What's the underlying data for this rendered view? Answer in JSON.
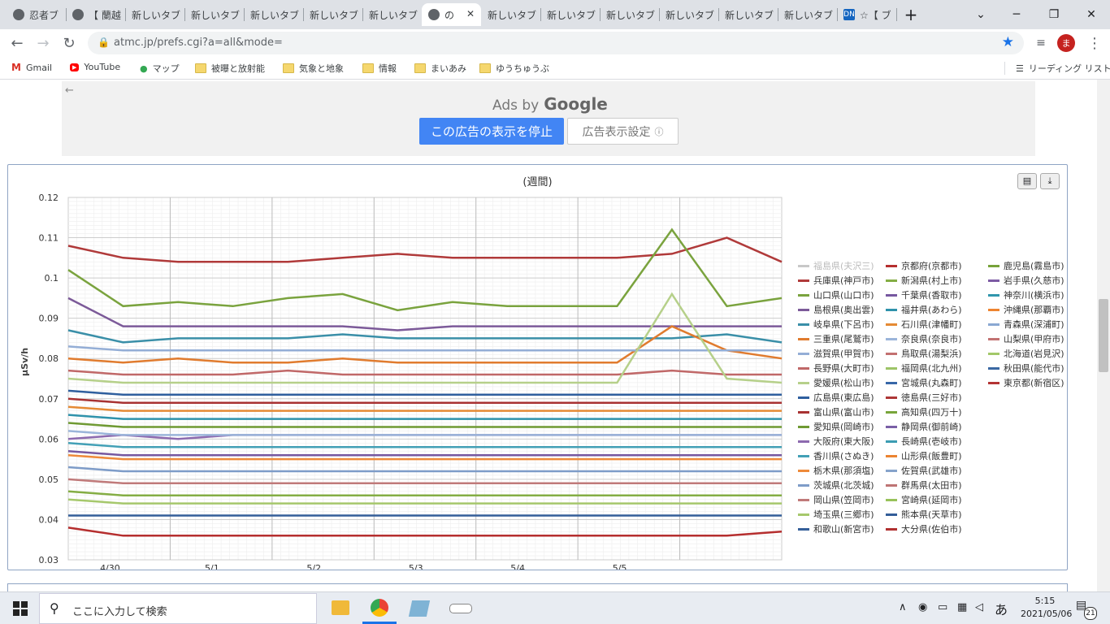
{
  "browser": {
    "tabs": [
      {
        "label": "忍者ブ",
        "icon": "globe-icon"
      },
      {
        "label": "【 蘭越",
        "icon": "globe-icon"
      },
      {
        "label": "新しいタブ",
        "icon": ""
      },
      {
        "label": "新しいタブ",
        "icon": ""
      },
      {
        "label": "新しいタブ",
        "icon": ""
      },
      {
        "label": "新しいタブ",
        "icon": ""
      },
      {
        "label": "新しいタブ",
        "icon": ""
      },
      {
        "label": "の",
        "icon": "globe-icon",
        "active": true
      },
      {
        "label": "新しいタブ",
        "icon": ""
      },
      {
        "label": "新しいタブ",
        "icon": ""
      },
      {
        "label": "新しいタブ",
        "icon": ""
      },
      {
        "label": "新しいタブ",
        "icon": ""
      },
      {
        "label": "新しいタブ",
        "icon": ""
      },
      {
        "label": "新しいタブ",
        "icon": ""
      },
      {
        "label": "☆【 ブ",
        "icon": "dn-icon"
      }
    ],
    "url": "atmc.jp/prefs.cgi?a=all&mode=",
    "profile_initial": "ま",
    "bookmarks": [
      {
        "label": "Gmail",
        "icon": "gmail-icon"
      },
      {
        "label": "YouTube",
        "icon": "youtube-icon"
      },
      {
        "label": "マップ",
        "icon": "maps-icon"
      },
      {
        "label": "被曝と放射能",
        "icon": "folder-icon"
      },
      {
        "label": "気象と地象",
        "icon": "folder-icon"
      },
      {
        "label": "情報",
        "icon": "folder-icon"
      },
      {
        "label": "まいあみ",
        "icon": "folder-icon"
      },
      {
        "label": "ゆうちゅうぶ",
        "icon": "folder-icon"
      }
    ],
    "reading_list": "リーディング リスト"
  },
  "ad": {
    "ads_by": "Ads by",
    "google": "Google",
    "stop_button": "この広告の表示を停止",
    "settings_button": "広告表示設定",
    "info_glyph": "ⓘ"
  },
  "chart_data": {
    "type": "line",
    "title": "(週間)",
    "ylabel": "μSv/h",
    "xlabel": "",
    "ylim": [
      0.03,
      0.12
    ],
    "yticks": [
      "0.12",
      "0.11",
      "0.1",
      "0.09",
      "0.08",
      "0.07",
      "0.06",
      "0.05",
      "0.04",
      "0.03"
    ],
    "xticks": [
      "4/30",
      "5/1",
      "5/2",
      "5/3",
      "5/4",
      "5/5"
    ],
    "x": [
      "4/29 12:00",
      "4/30 0:00",
      "4/30 12:00",
      "5/1 0:00",
      "5/1 12:00",
      "5/2 0:00",
      "5/2 12:00",
      "5/3 0:00",
      "5/3 12:00",
      "5/4 0:00",
      "5/4 12:00",
      "5/5 0:00",
      "5/5 12:00",
      "5/6 0:00"
    ],
    "series": [
      {
        "name": "福島県(夫沢三)",
        "color": "#c8c8c8",
        "values": [
          null,
          null,
          null,
          null,
          null,
          null,
          null,
          null,
          null,
          null,
          null,
          null,
          null,
          null
        ]
      },
      {
        "name": "兵庫県(神戸市)",
        "color": "#b03a3a",
        "values": [
          0.108,
          0.105,
          0.104,
          0.104,
          0.104,
          0.105,
          0.106,
          0.105,
          0.105,
          0.105,
          0.105,
          0.106,
          0.11,
          0.104
        ]
      },
      {
        "name": "山口県(山口市)",
        "color": "#7aa33e",
        "values": [
          0.102,
          0.093,
          0.094,
          0.093,
          0.095,
          0.096,
          0.092,
          0.094,
          0.093,
          0.093,
          0.093,
          0.112,
          0.093,
          0.095
        ]
      },
      {
        "name": "島根県(奥出雲)",
        "color": "#7c5a99",
        "values": [
          0.095,
          0.088,
          0.088,
          0.088,
          0.088,
          0.088,
          0.087,
          0.088,
          0.088,
          0.088,
          0.088,
          0.088,
          0.088,
          0.088
        ]
      },
      {
        "name": "岐阜県(下呂市)",
        "color": "#3a8fa8",
        "values": [
          0.087,
          0.084,
          0.085,
          0.085,
          0.085,
          0.086,
          0.085,
          0.085,
          0.085,
          0.085,
          0.085,
          0.085,
          0.086,
          0.084
        ]
      },
      {
        "name": "三重県(尾鷲市)",
        "color": "#e07b2e",
        "values": [
          0.08,
          0.079,
          0.08,
          0.079,
          0.079,
          0.08,
          0.079,
          0.079,
          0.079,
          0.079,
          0.079,
          0.088,
          0.082,
          0.08
        ]
      },
      {
        "name": "滋賀県(甲賀市)",
        "color": "#94aed6",
        "values": [
          0.083,
          0.082,
          0.082,
          0.082,
          0.082,
          0.082,
          0.082,
          0.082,
          0.082,
          0.082,
          0.082,
          0.082,
          0.082,
          0.082
        ]
      },
      {
        "name": "長野県(大町市)",
        "color": "#c06868",
        "values": [
          0.077,
          0.076,
          0.076,
          0.076,
          0.077,
          0.076,
          0.076,
          0.076,
          0.076,
          0.076,
          0.076,
          0.077,
          0.076,
          0.076
        ]
      },
      {
        "name": "愛媛県(松山市)",
        "color": "#b6d08a",
        "values": [
          0.075,
          0.074,
          0.074,
          0.074,
          0.074,
          0.074,
          0.074,
          0.074,
          0.074,
          0.074,
          0.074,
          0.096,
          0.075,
          0.074
        ]
      },
      {
        "name": "広島県(東広島)",
        "color": "#2f5f9e",
        "values": [
          0.072,
          0.071,
          0.071,
          0.071,
          0.071,
          0.071,
          0.071,
          0.071,
          0.071,
          0.071,
          0.071,
          0.071,
          0.071,
          0.071
        ]
      },
      {
        "name": "富山県(富山市)",
        "color": "#a83232",
        "values": [
          0.07,
          0.069,
          0.069,
          0.069,
          0.069,
          0.069,
          0.069,
          0.069,
          0.069,
          0.069,
          0.069,
          0.069,
          0.069,
          0.069
        ]
      },
      {
        "name": "愛知県(岡崎市)",
        "color": "#6f9a33",
        "values": [
          0.064,
          0.063,
          0.063,
          0.063,
          0.063,
          0.063,
          0.063,
          0.063,
          0.063,
          0.063,
          0.063,
          0.063,
          0.063,
          0.063
        ]
      },
      {
        "name": "大阪府(東大阪)",
        "color": "#8d6aaf",
        "values": [
          0.06,
          0.061,
          0.06,
          0.061,
          0.061,
          0.061,
          0.061,
          0.061,
          0.061,
          0.061,
          0.061,
          0.061,
          0.061,
          0.061
        ]
      },
      {
        "name": "香川県(さぬき)",
        "color": "#43a0b6",
        "values": [
          0.059,
          0.058,
          0.058,
          0.058,
          0.058,
          0.058,
          0.058,
          0.058,
          0.058,
          0.058,
          0.058,
          0.058,
          0.058,
          0.058
        ]
      },
      {
        "name": "栃木県(那須塩)",
        "color": "#ee8a3a",
        "values": [
          0.056,
          0.055,
          0.055,
          0.055,
          0.055,
          0.055,
          0.055,
          0.055,
          0.055,
          0.055,
          0.055,
          0.055,
          0.055,
          0.055
        ]
      },
      {
        "name": "茨城県(北茨城)",
        "color": "#7e9cc8",
        "values": [
          0.053,
          0.052,
          0.052,
          0.052,
          0.052,
          0.052,
          0.052,
          0.052,
          0.052,
          0.052,
          0.052,
          0.052,
          0.052,
          0.052
        ]
      },
      {
        "name": "岡山県(笠岡市)",
        "color": "#c07a7a",
        "values": [
          0.05,
          0.049,
          0.049,
          0.049,
          0.049,
          0.049,
          0.049,
          0.049,
          0.049,
          0.049,
          0.049,
          0.049,
          0.049,
          0.049
        ]
      },
      {
        "name": "埼玉県(三郷市)",
        "color": "#a6c86c",
        "values": [
          0.045,
          0.044,
          0.044,
          0.044,
          0.044,
          0.044,
          0.044,
          0.044,
          0.044,
          0.044,
          0.044,
          0.044,
          0.044,
          0.044
        ]
      },
      {
        "name": "和歌山(新宮市)",
        "color": "#355f99",
        "values": [
          0.041,
          0.041,
          0.041,
          0.041,
          0.041,
          0.041,
          0.041,
          0.041,
          0.041,
          0.041,
          0.041,
          0.041,
          0.041,
          0.041
        ]
      },
      {
        "name": "京都府(京都市)",
        "color": "#b52e2e",
        "values": [
          0.038,
          0.036,
          0.036,
          0.036,
          0.036,
          0.036,
          0.036,
          0.036,
          0.036,
          0.036,
          0.036,
          0.036,
          0.036,
          0.037
        ]
      },
      {
        "name": "新潟県(村上市)",
        "color": "#84ad44",
        "values": [
          0.047,
          0.046,
          0.046,
          0.046,
          0.046,
          0.046,
          0.046,
          0.046,
          0.046,
          0.046,
          0.046,
          0.046,
          0.046,
          0.046
        ]
      },
      {
        "name": "千葉県(香取市)",
        "color": "#7658a0",
        "values": [
          0.057,
          0.056,
          0.056,
          0.056,
          0.056,
          0.056,
          0.056,
          0.056,
          0.056,
          0.056,
          0.056,
          0.056,
          0.056,
          0.056
        ]
      },
      {
        "name": "福井県(あわら)",
        "color": "#2e92ab",
        "values": [
          0.066,
          0.065,
          0.065,
          0.065,
          0.065,
          0.065,
          0.065,
          0.065,
          0.065,
          0.065,
          0.065,
          0.065,
          0.065,
          0.065
        ]
      },
      {
        "name": "石川県(津幡町)",
        "color": "#e58a34",
        "values": [
          0.068,
          0.067,
          0.067,
          0.067,
          0.067,
          0.067,
          0.067,
          0.067,
          0.067,
          0.067,
          0.067,
          0.067,
          0.067,
          0.067
        ]
      },
      {
        "name": "奈良県(奈良市)",
        "color": "#9bb5da",
        "values": [
          0.062,
          0.061,
          0.061,
          0.061,
          0.061,
          0.061,
          0.061,
          0.061,
          0.061,
          0.061,
          0.061,
          0.061,
          0.061,
          0.061
        ]
      }
    ],
    "legend_placement": "right",
    "legend_columns": [
      [
        "福島県(夫沢三)",
        "兵庫県(神戸市)",
        "山口県(山口市)",
        "島根県(奥出雲)",
        "岐阜県(下呂市)",
        "三重県(尾鷲市)",
        "滋賀県(甲賀市)",
        "長野県(大町市)",
        "愛媛県(松山市)",
        "広島県(東広島)",
        "富山県(富山市)",
        "愛知県(岡崎市)",
        "大阪府(東大阪)",
        "香川県(さぬき)",
        "栃木県(那須塩)",
        "茨城県(北茨城)",
        "岡山県(笠岡市)",
        "埼玉県(三郷市)",
        "和歌山(新宮市)"
      ],
      [
        "京都府(京都市)",
        "新潟県(村上市)",
        "千葉県(香取市)",
        "福井県(あわら)",
        "石川県(津幡町)",
        "奈良県(奈良市)",
        "鳥取県(湯梨浜)",
        "福岡県(北九州)",
        "宮城県(丸森町)",
        "徳島県(三好市)",
        "高知県(四万十)",
        "静岡県(御前崎)",
        "長崎県(壱岐市)",
        "山形県(飯豊町)",
        "佐賀県(武雄市)",
        "群馬県(太田市)",
        "宮崎県(延岡市)",
        "熊本県(天草市)",
        "大分県(佐伯市)"
      ],
      [
        "鹿児島(霧島市)",
        "岩手県(久慈市)",
        "神奈川(横浜市)",
        "沖縄県(那覇市)",
        "青森県(深浦町)",
        "山梨県(甲府市)",
        "北海道(岩見沢)",
        "秋田県(能代市)",
        "東京都(新宿区)"
      ]
    ],
    "legend_colors": [
      [
        "#c8c8c8",
        "#b03a3a",
        "#7aa33e",
        "#7c5a99",
        "#3a8fa8",
        "#e07b2e",
        "#94aed6",
        "#c06868",
        "#b6d08a",
        "#2f5f9e",
        "#a83232",
        "#6f9a33",
        "#8d6aaf",
        "#43a0b6",
        "#ee8a3a",
        "#7e9cc8",
        "#c07a7a",
        "#a6c86c",
        "#355f99"
      ],
      [
        "#b52e2e",
        "#84ad44",
        "#7658a0",
        "#2e92ab",
        "#e58a34",
        "#9bb5da",
        "#c37070",
        "#9dc467",
        "#3867a8",
        "#ad3636",
        "#78a53b",
        "#7a5fa6",
        "#3c9cb2",
        "#eb8431",
        "#86a3cb",
        "#be7474",
        "#98c25a",
        "#335d98",
        "#b03030"
      ],
      [
        "#77a23a",
        "#7d5ba4",
        "#3096ad",
        "#ee8430",
        "#8aa8d2",
        "#c27272",
        "#a2c869",
        "#3a68a3",
        "#b43434"
      ]
    ]
  },
  "taskbar": {
    "search_placeholder": "ここに入力して検索",
    "ime": "あ",
    "time": "5:15",
    "date": "2021/05/06",
    "notify_count": "21"
  }
}
